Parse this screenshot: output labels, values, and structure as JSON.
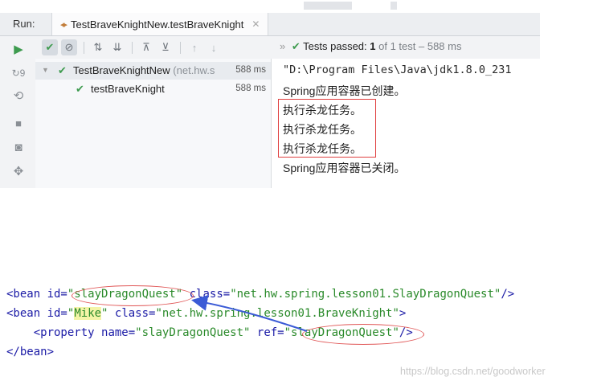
{
  "topbar": {
    "cutoff_text": "··· ···········"
  },
  "run_panel": {
    "label": "Run:",
    "tab_title": "TestBraveKnightNew.testBraveKnight",
    "status": {
      "prefix": "Tests passed:",
      "count": "1",
      "rest": "of 1 test – 588 ms"
    },
    "tree": [
      {
        "name": "TestBraveKnightNew",
        "pkg": "(net.hw.s",
        "time": "588 ms"
      },
      {
        "name": "testBraveKnight",
        "time": "588 ms"
      }
    ],
    "console": [
      "\"D:\\Program Files\\Java\\jdk1.8.0_231",
      "Spring应用容器已创建。",
      "执行杀龙任务。",
      "执行杀龙任务。",
      "执行杀龙任务。",
      "Spring应用容器已关闭。"
    ]
  },
  "xml": {
    "line1": {
      "open": "<bean ",
      "id_attr": "id=",
      "id_val": "\"slayDragonQuest\"",
      "class_attr": " class=",
      "class_val": "\"net.hw.spring.lesson01.SlayDragonQuest\"",
      "close": "/>"
    },
    "line2": {
      "open": "<bean ",
      "id_attr": "id=",
      "q1": "\"",
      "id_val": "Mike",
      "q2": "\"",
      "class_attr": " class=",
      "class_val": "\"net.hw.spring.lesson01.BraveKnight\"",
      "close": ">"
    },
    "line3": {
      "indent": "    ",
      "open": "<property ",
      "name_attr": "name=",
      "name_val": "\"slayDragonQuest\"",
      "ref_attr": " ref=",
      "ref_val": "\"slayDragonQuest\"",
      "close": "/>"
    },
    "line4": {
      "text": "</bean>"
    }
  },
  "watermark": "https://blog.csdn.net/goodworker"
}
